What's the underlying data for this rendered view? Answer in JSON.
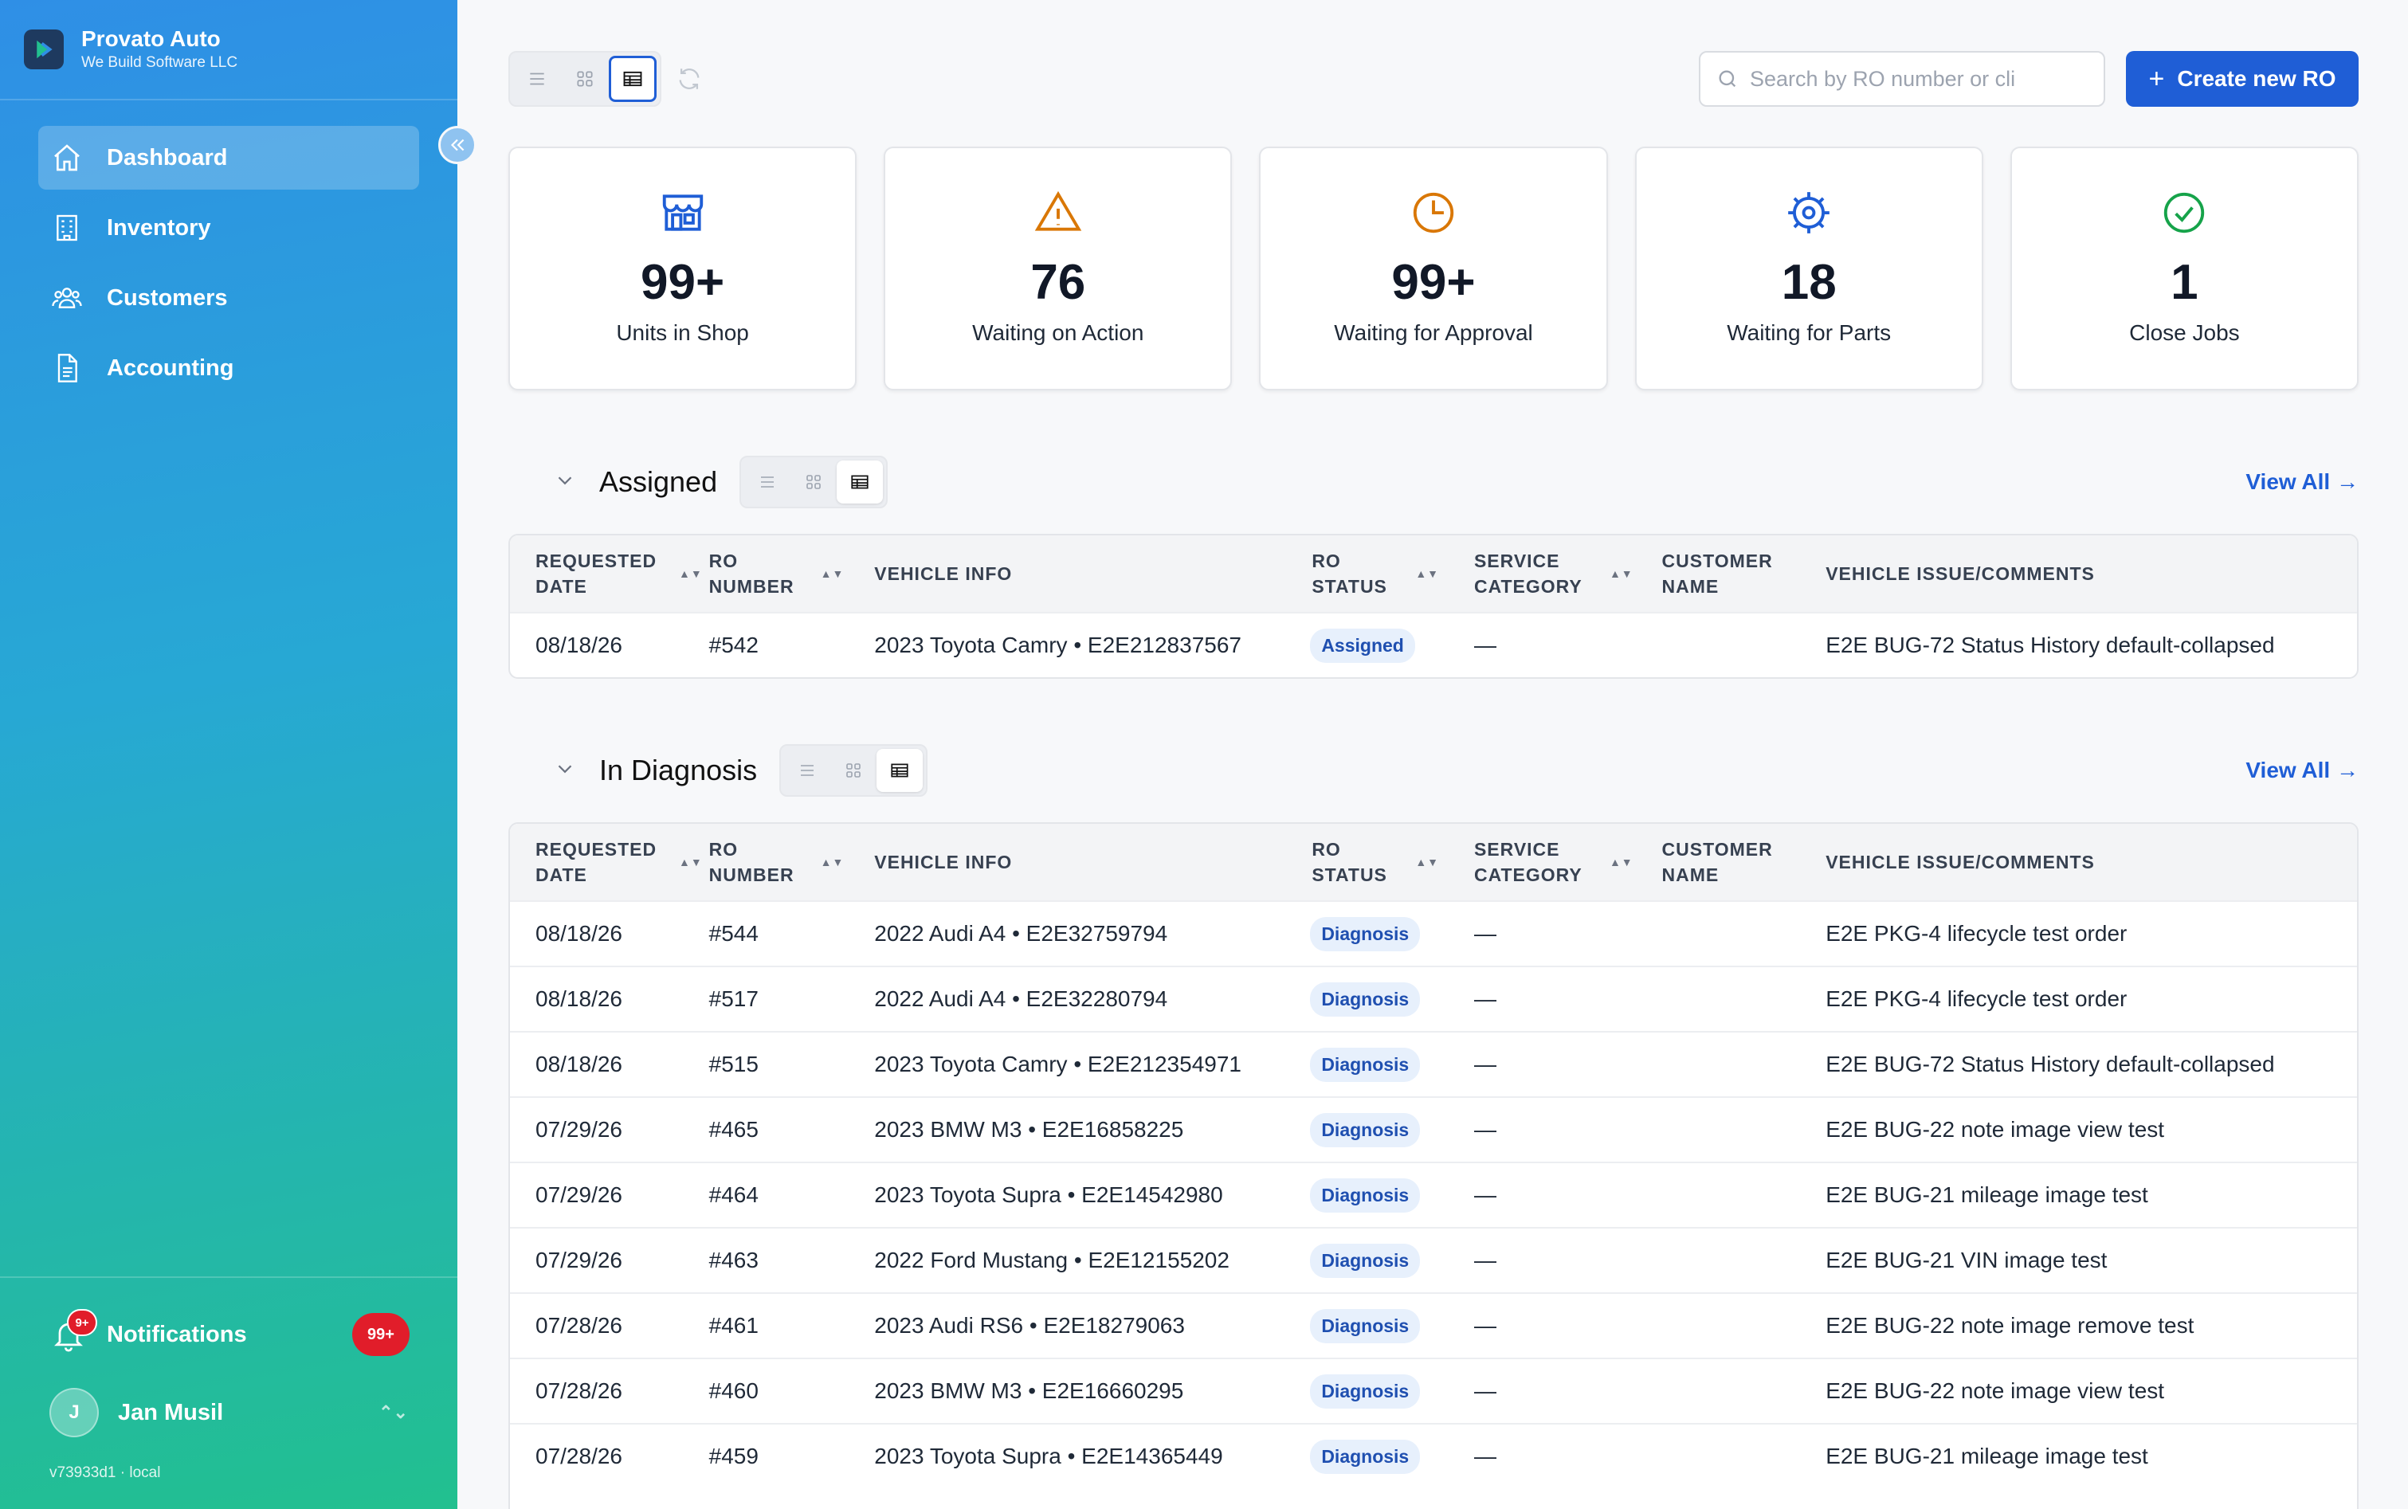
{
  "brand": {
    "name": "Provato Auto",
    "subtitle": "We Build Software LLC"
  },
  "nav": [
    {
      "label": "Dashboard",
      "icon": "home-icon",
      "active": true
    },
    {
      "label": "Inventory",
      "icon": "building-icon"
    },
    {
      "label": "Customers",
      "icon": "users-icon"
    },
    {
      "label": "Accounting",
      "icon": "document-icon"
    }
  ],
  "notifications": {
    "label": "Notifications",
    "icon_badge": "9+",
    "count": "99+"
  },
  "user": {
    "initial": "J",
    "name": "Jan Musil"
  },
  "version": "v73933d1 · local",
  "toolbar": {
    "search_placeholder": "Search by RO number or cli",
    "create_label": "Create new RO"
  },
  "stats": [
    {
      "value": "99+",
      "label": "Units in Shop",
      "icon": "store-icon",
      "color": "#1f5ed6"
    },
    {
      "value": "76",
      "label": "Waiting on Action",
      "icon": "warning-icon",
      "color": "#d97706"
    },
    {
      "value": "99+",
      "label": "Waiting for Approval",
      "icon": "clock-icon",
      "color": "#d97706"
    },
    {
      "value": "18",
      "label": "Waiting for Parts",
      "icon": "gear-icon",
      "color": "#1f5ed6"
    },
    {
      "value": "1",
      "label": "Close Jobs",
      "icon": "check-circle-icon",
      "color": "#16a34a"
    }
  ],
  "columns": {
    "requested_date": "REQUESTED DATE",
    "ro_number": "RO NUMBER",
    "vehicle_info": "VEHICLE INFO",
    "ro_status": "RO STATUS",
    "service_category": "SERVICE CATEGORY",
    "customer_name": "CUSTOMER NAME",
    "vehicle_issue": "VEHICLE ISSUE/COMMENTS"
  },
  "view_all": "View All →",
  "sections": [
    {
      "title": "Assigned",
      "rows": [
        {
          "date": "08/18/26",
          "ro": "#542",
          "vehicle": "2023 Toyota Camry • E2E212837567",
          "status": "Assigned",
          "category": "—",
          "customer": "",
          "issue": "E2E BUG-72 Status History default-collapsed"
        }
      ]
    },
    {
      "title": "In Diagnosis",
      "rows": [
        {
          "date": "08/18/26",
          "ro": "#544",
          "vehicle": "2022 Audi A4 • E2E32759794",
          "status": "Diagnosis",
          "category": "—",
          "customer": "",
          "issue": "E2E PKG-4 lifecycle test order"
        },
        {
          "date": "08/18/26",
          "ro": "#517",
          "vehicle": "2022 Audi A4 • E2E32280794",
          "status": "Diagnosis",
          "category": "—",
          "customer": "",
          "issue": "E2E PKG-4 lifecycle test order"
        },
        {
          "date": "08/18/26",
          "ro": "#515",
          "vehicle": "2023 Toyota Camry • E2E212354971",
          "status": "Diagnosis",
          "category": "—",
          "customer": "",
          "issue": "E2E BUG-72 Status History default-collapsed"
        },
        {
          "date": "07/29/26",
          "ro": "#465",
          "vehicle": "2023 BMW M3 • E2E16858225",
          "status": "Diagnosis",
          "category": "—",
          "customer": "",
          "issue": "E2E BUG-22 note image view test"
        },
        {
          "date": "07/29/26",
          "ro": "#464",
          "vehicle": "2023 Toyota Supra • E2E14542980",
          "status": "Diagnosis",
          "category": "—",
          "customer": "",
          "issue": "E2E BUG-21 mileage image test"
        },
        {
          "date": "07/29/26",
          "ro": "#463",
          "vehicle": "2022 Ford Mustang • E2E12155202",
          "status": "Diagnosis",
          "category": "—",
          "customer": "",
          "issue": "E2E BUG-21 VIN image test"
        },
        {
          "date": "07/28/26",
          "ro": "#461",
          "vehicle": "2023 Audi RS6 • E2E18279063",
          "status": "Diagnosis",
          "category": "—",
          "customer": "",
          "issue": "E2E BUG-22 note image remove test"
        },
        {
          "date": "07/28/26",
          "ro": "#460",
          "vehicle": "2023 BMW M3 • E2E16660295",
          "status": "Diagnosis",
          "category": "—",
          "customer": "",
          "issue": "E2E BUG-22 note image view test"
        },
        {
          "date": "07/28/26",
          "ro": "#459",
          "vehicle": "2023 Toyota Supra • E2E14365449",
          "status": "Diagnosis",
          "category": "—",
          "customer": "",
          "issue": "E2E BUG-21 mileage image test"
        }
      ]
    }
  ]
}
